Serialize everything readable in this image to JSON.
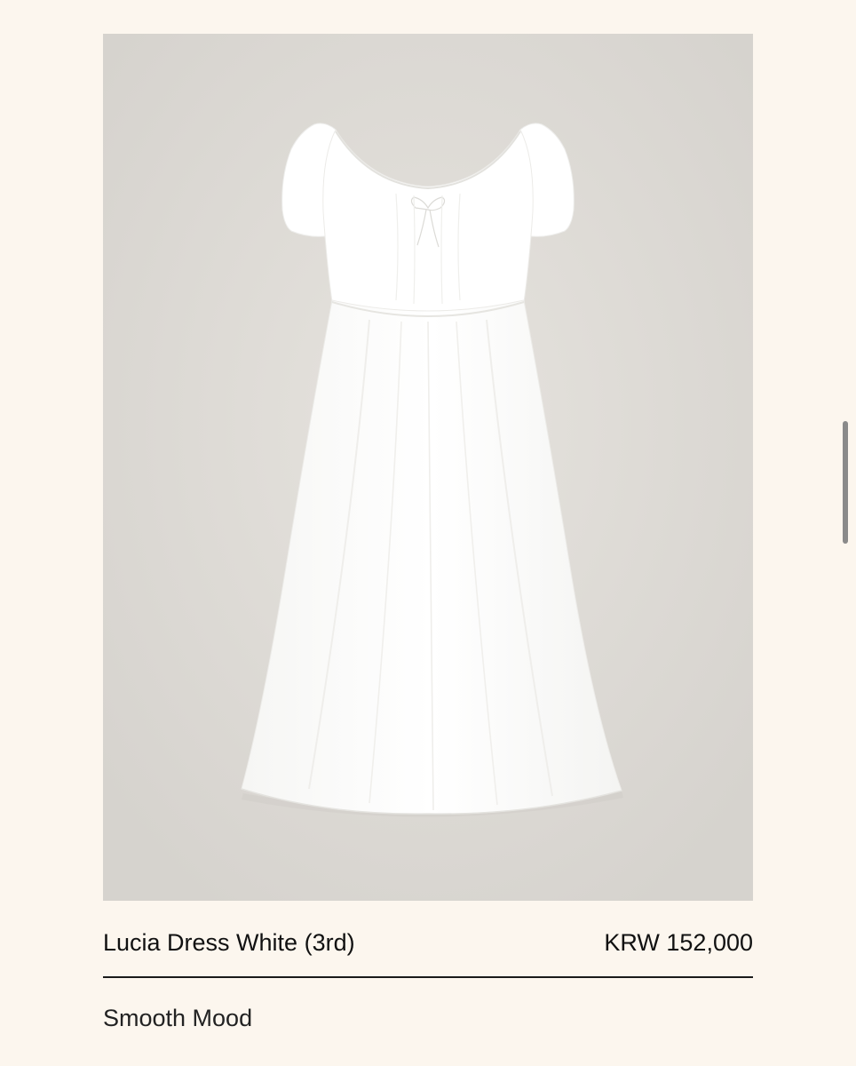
{
  "product": {
    "name": "Lucia Dress White (3rd)",
    "price": "KRW 152,000",
    "description": "Smooth Mood"
  },
  "colors": {
    "page_background": "#fcf6ee",
    "image_background": "#dddad5",
    "text": "#111111",
    "divider": "#1a1a1a",
    "scrollbar": "#8a8a8a"
  }
}
